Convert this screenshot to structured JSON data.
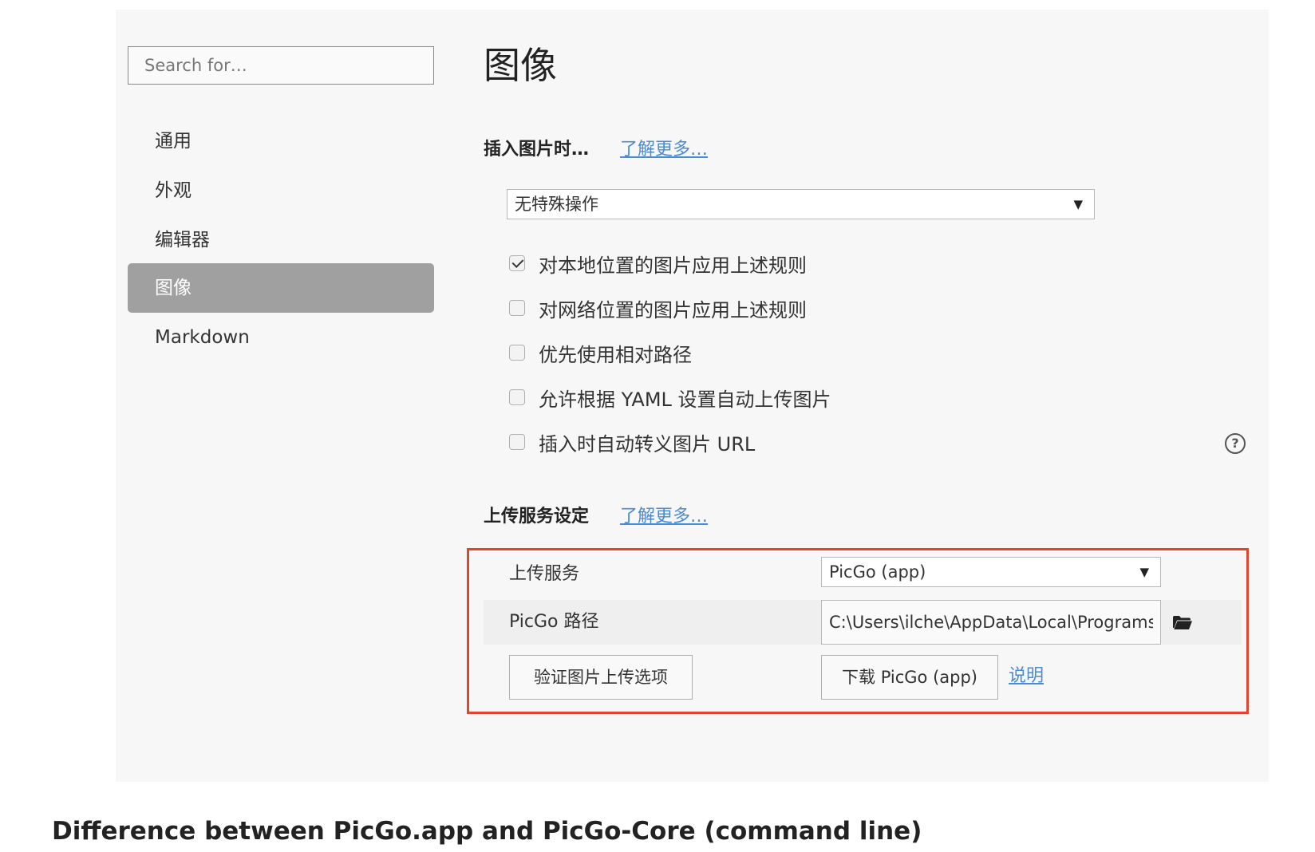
{
  "sidebar": {
    "search_placeholder": "Search for…",
    "items": [
      {
        "label": "通用",
        "active": false
      },
      {
        "label": "外观",
        "active": false
      },
      {
        "label": "编辑器",
        "active": false
      },
      {
        "label": "图像",
        "active": true
      },
      {
        "label": "Markdown",
        "active": false
      }
    ]
  },
  "main": {
    "title": "图像",
    "insert_section": {
      "heading": "插入图片时…",
      "learn_more": "了解更多…",
      "action_select": "无特殊操作",
      "options": [
        {
          "label": "对本地位置的图片应用上述规则",
          "checked": true
        },
        {
          "label": "对网络位置的图片应用上述规则",
          "checked": false
        },
        {
          "label": "优先使用相对路径",
          "checked": false
        },
        {
          "label": "允许根据 YAML 设置自动上传图片",
          "checked": false
        },
        {
          "label": "插入时自动转义图片 URL",
          "checked": false
        }
      ],
      "help_icon": "?"
    },
    "upload_section": {
      "heading": "上传服务设定",
      "learn_more": "了解更多…",
      "service_label": "上传服务",
      "service_value": "PicGo (app)",
      "path_label": "PicGo 路径",
      "path_value": "C:\\Users\\ilche\\AppData\\Local\\Programs\\",
      "verify_button": "验证图片上传选项",
      "download_button": "下载 PicGo (app)",
      "doc_link": "说明"
    },
    "highlight_color": "#e0452f"
  },
  "caption": "Difference between PicGo.app and PicGo-Core (command line)"
}
